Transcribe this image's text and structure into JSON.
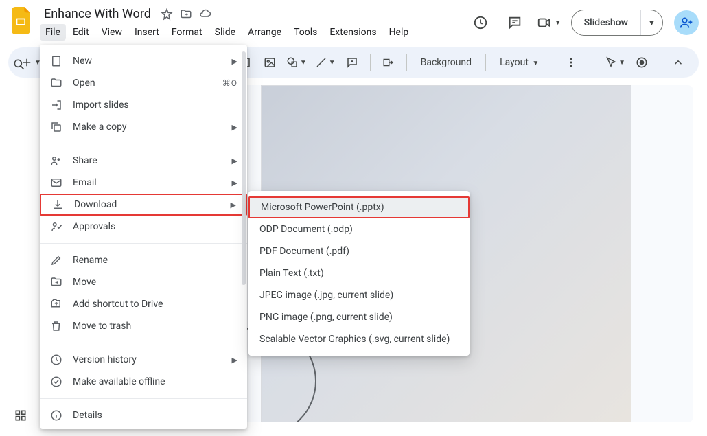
{
  "doc_title": "Enhance With Word",
  "menubar": [
    "File",
    "Edit",
    "View",
    "Insert",
    "Format",
    "Slide",
    "Arrange",
    "Tools",
    "Extensions",
    "Help"
  ],
  "active_menu_index": 0,
  "header_buttons": {
    "slideshow": "Slideshow"
  },
  "toolbar": {
    "background": "Background",
    "layout": "Layout"
  },
  "file_menu": {
    "groups": [
      [
        {
          "icon": "new",
          "label": "New",
          "submenu": true
        },
        {
          "icon": "open",
          "label": "Open",
          "shortcut": "⌘O"
        },
        {
          "icon": "import",
          "label": "Import slides"
        },
        {
          "icon": "copy",
          "label": "Make a copy",
          "submenu": true
        }
      ],
      [
        {
          "icon": "share",
          "label": "Share",
          "submenu": true
        },
        {
          "icon": "email",
          "label": "Email",
          "submenu": true
        },
        {
          "icon": "download",
          "label": "Download",
          "submenu": true,
          "highlight": true
        },
        {
          "icon": "approvals",
          "label": "Approvals"
        }
      ],
      [
        {
          "icon": "rename",
          "label": "Rename"
        },
        {
          "icon": "move",
          "label": "Move"
        },
        {
          "icon": "shortcut",
          "label": "Add shortcut to Drive"
        },
        {
          "icon": "trash",
          "label": "Move to trash"
        }
      ],
      [
        {
          "icon": "history",
          "label": "Version history",
          "submenu": true
        },
        {
          "icon": "offline",
          "label": "Make available offline"
        }
      ],
      [
        {
          "icon": "info",
          "label": "Details"
        }
      ]
    ]
  },
  "download_submenu": {
    "items": [
      {
        "label": "Microsoft PowerPoint (.pptx)",
        "highlight": true
      },
      {
        "label": "ODP Document (.odp)"
      },
      {
        "label": "PDF Document (.pdf)"
      },
      {
        "label": "Plain Text (.txt)"
      },
      {
        "label": "JPEG image (.jpg, current slide)"
      },
      {
        "label": "PNG image (.png, current slide)"
      },
      {
        "label": "Scalable Vector Graphics (.svg, current slide)"
      }
    ]
  }
}
